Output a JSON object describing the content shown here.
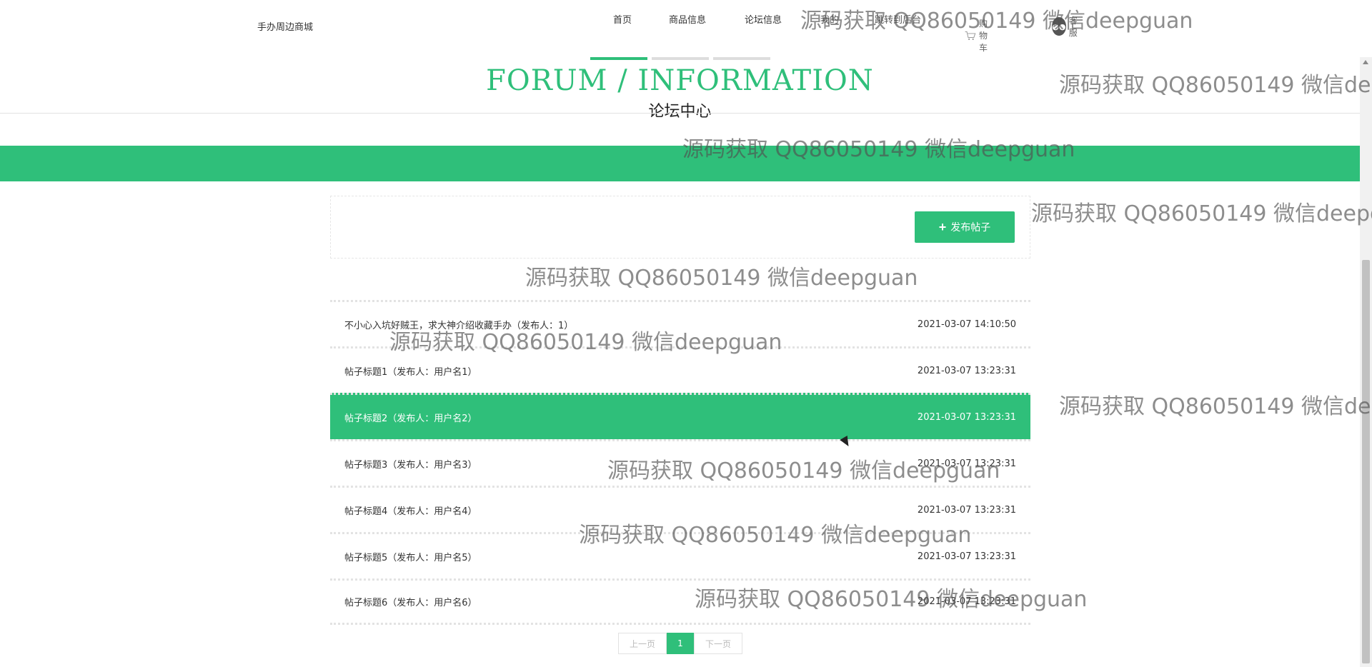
{
  "header": {
    "brand": "手办周边商城",
    "nav": {
      "home": "首页",
      "goods": "商品信息",
      "forum": "论坛信息",
      "mine": "我的",
      "admin": "跳转到后台",
      "cart": "购物车",
      "service": "客服"
    }
  },
  "title": {
    "en": "FORUM / INFORMATION",
    "cn": "论坛中心"
  },
  "toolbar": {
    "publish_label": "发布帖子"
  },
  "posts": [
    {
      "title": "不小心入坑好贼王，求大神介绍收藏手办（发布人：1）",
      "time": "2021-03-07 14:10:50"
    },
    {
      "title": "帖子标题1（发布人：用户名1）",
      "time": "2021-03-07 13:23:31"
    },
    {
      "title": "帖子标题2（发布人：用户名2）",
      "time": "2021-03-07 13:23:31"
    },
    {
      "title": "帖子标题3（发布人：用户名3）",
      "time": "2021-03-07 13:23:31"
    },
    {
      "title": "帖子标题4（发布人：用户名4）",
      "time": "2021-03-07 13:23:31"
    },
    {
      "title": "帖子标题5（发布人：用户名5）",
      "time": "2021-03-07 13:23:31"
    },
    {
      "title": "帖子标题6（发布人：用户名6）",
      "time": "2021-03-07 13:23:31"
    }
  ],
  "pagination": {
    "prev": "上一页",
    "current": "1",
    "next": "下一页"
  },
  "watermark": "源码获取 QQ86050149 微信deepguan",
  "colors": {
    "accent": "#2fbf7a"
  }
}
